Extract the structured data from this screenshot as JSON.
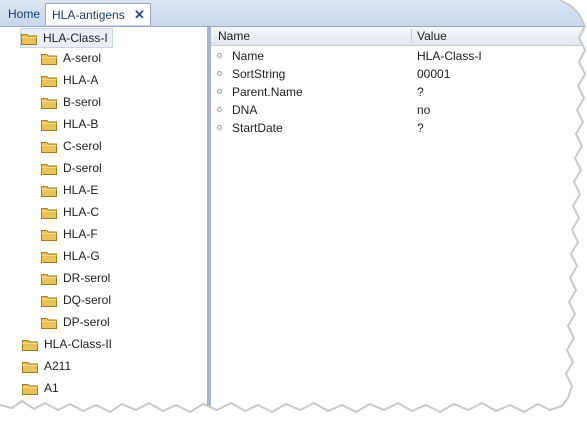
{
  "tabs": [
    {
      "label": "Home"
    },
    {
      "label": "HLA-antigens",
      "close": "✕"
    }
  ],
  "tree": {
    "items": [
      {
        "label": "HLA-Class-I"
      },
      {
        "label": "A-serol"
      },
      {
        "label": "HLA-A"
      },
      {
        "label": "B-serol"
      },
      {
        "label": "HLA-B"
      },
      {
        "label": "C-serol"
      },
      {
        "label": "D-serol"
      },
      {
        "label": "HLA-E"
      },
      {
        "label": "HLA-C"
      },
      {
        "label": "HLA-F"
      },
      {
        "label": "HLA-G"
      },
      {
        "label": "DR-serol"
      },
      {
        "label": "DQ-serol"
      },
      {
        "label": "DP-serol"
      },
      {
        "label": "HLA-Class-II"
      },
      {
        "label": "A211"
      },
      {
        "label": "A1"
      }
    ]
  },
  "properties": {
    "col_name": "Name",
    "col_value": "Value",
    "rows": [
      {
        "name": "Name",
        "value": "HLA-Class-I"
      },
      {
        "name": "SortString",
        "value": "00001"
      },
      {
        "name": "Parent.Name",
        "value": "?"
      },
      {
        "name": "DNA",
        "value": "no"
      },
      {
        "name": "StartDate",
        "value": "?"
      }
    ]
  },
  "colors": {
    "folder": "#e8c35a",
    "accent": "#2b4c7e"
  }
}
